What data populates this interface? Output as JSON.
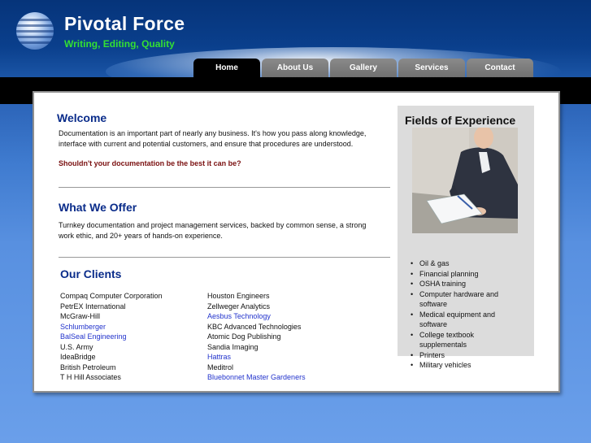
{
  "site": {
    "title": "Pivotal Force",
    "tagline": "Writing, Editing, Quality"
  },
  "nav": [
    {
      "label": "Home",
      "active": true
    },
    {
      "label": "About Us",
      "active": false
    },
    {
      "label": "Gallery",
      "active": false
    },
    {
      "label": "Services",
      "active": false
    },
    {
      "label": "Contact",
      "active": false
    }
  ],
  "welcome": {
    "heading": "Welcome",
    "line1": "Documentation is an important part of nearly any business. It's how you pass along knowledge,",
    "line2": "interface with current and potential customers, and ensure that procedures are understood.",
    "question": "Shouldn't your documentation be the best it can be?"
  },
  "offer": {
    "heading": "What We Offer",
    "line1": "Turnkey documentation and project management services, backed by common sense, a strong",
    "line2": "work ethic, and 20+ years of hands-on experience."
  },
  "clients": {
    "heading": "Our Clients",
    "left": [
      {
        "name": "Compaq Computer Corporation",
        "link": false
      },
      {
        "name": "PetrEX International",
        "link": false
      },
      {
        "name": "McGraw-Hill",
        "link": false
      },
      {
        "name": "Schlumberger",
        "link": true
      },
      {
        "name": "BalSeal Engineering",
        "link": true
      },
      {
        "name": "U.S. Army",
        "link": false
      },
      {
        "name": "IdeaBridge",
        "link": false
      },
      {
        "name": "British Petroleum",
        "link": false
      },
      {
        "name": "T H Hill Associates",
        "link": false
      }
    ],
    "right": [
      {
        "name": "Houston Engineers",
        "link": false
      },
      {
        "name": "Zellweger Analytics",
        "link": false
      },
      {
        "name": "Aesbus Technology",
        "link": true
      },
      {
        "name": "KBC Advanced Technologies",
        "link": false
      },
      {
        "name": "Atomic Dog Publishing",
        "link": false
      },
      {
        "name": "Sandia Imaging",
        "link": false
      },
      {
        "name": "Hattras",
        "link": true
      },
      {
        "name": "Meditrol",
        "link": false
      },
      {
        "name": "Bluebonnet Master Gardeners",
        "link": true
      }
    ]
  },
  "sidebar": {
    "heading": "Fields of Experience",
    "photo_icon": "businesswoman-writing-photo",
    "fields": [
      "Oil & gas",
      "Financial planning",
      "OSHA training",
      "Computer hardware and",
      "software",
      "Medical equipment and",
      "software",
      "College textbook",
      "supplementals",
      "Printers",
      "Military vehicles"
    ]
  },
  "colors": {
    "heading_blue": "#0a2c8a",
    "tagline_green": "#33e033",
    "link_blue": "#2233cc",
    "question_red": "#7a1010"
  }
}
